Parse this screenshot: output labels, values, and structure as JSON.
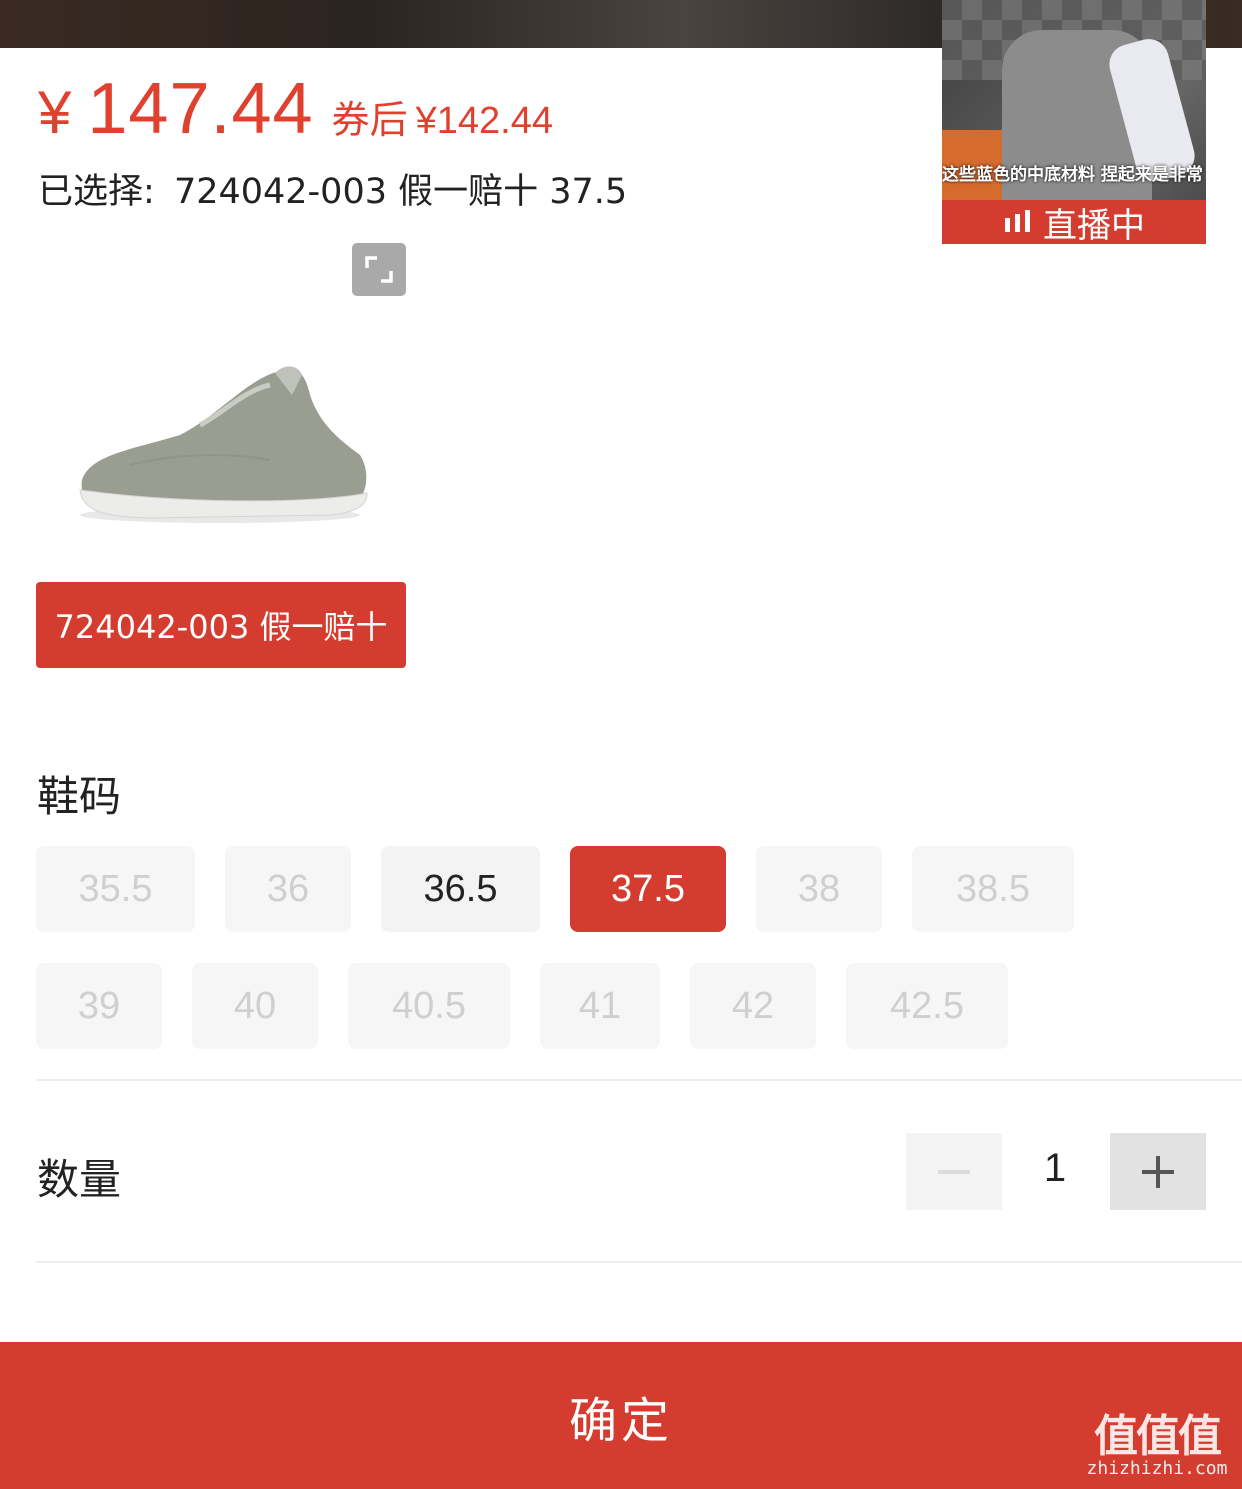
{
  "price": {
    "symbol": "¥",
    "value": "147.44",
    "coupon_label": "券后",
    "coupon_price": "¥142.44"
  },
  "selection": {
    "label": "已选择:",
    "value": "724042-003 假一赔十 37.5"
  },
  "variant": {
    "label": "724042-003 假一赔十"
  },
  "sizes": {
    "title": "鞋码",
    "items": [
      "35.5",
      "36",
      "36.5",
      "37.5",
      "38",
      "38.5",
      "39",
      "40",
      "40.5",
      "41",
      "42",
      "42.5"
    ],
    "selected": "37.5",
    "available": [
      "36.5",
      "37.5"
    ]
  },
  "quantity": {
    "title": "数量",
    "value": "1"
  },
  "confirm": {
    "label": "确定"
  },
  "live": {
    "caption": "这些蓝色的中底材料 捏起来是非常",
    "status": "直播中"
  },
  "watermark": {
    "brand": "值值值",
    "url": "zhizhizhi.com"
  },
  "colors": {
    "accent": "#d33c2e",
    "price": "#e0412f"
  }
}
